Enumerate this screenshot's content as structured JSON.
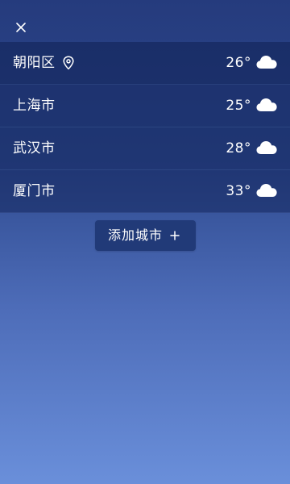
{
  "header": {
    "close_icon": "close-icon"
  },
  "cities": [
    {
      "name": "朝阳区",
      "temp": "26°",
      "is_current_location": true,
      "location_icon": "location-pin-icon",
      "weather_icon": "cloud-icon"
    },
    {
      "name": "上海市",
      "temp": "25°",
      "is_current_location": false,
      "weather_icon": "cloud-icon"
    },
    {
      "name": "武汉市",
      "temp": "28°",
      "is_current_location": false,
      "weather_icon": "cloud-icon"
    },
    {
      "name": "厦门市",
      "temp": "33°",
      "is_current_location": false,
      "weather_icon": "cloud-icon"
    }
  ],
  "add_city": {
    "label": "添加城市",
    "icon": "plus-icon"
  },
  "colors": {
    "background_top": "#253b7d",
    "background_bottom": "#6a8fda",
    "button_bg": "#213a78",
    "text": "#ffffff"
  }
}
